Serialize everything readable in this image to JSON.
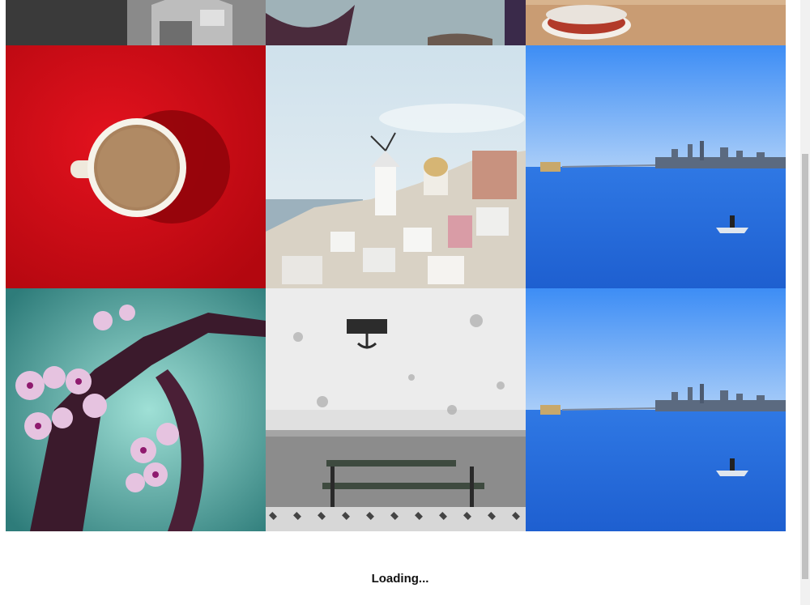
{
  "gallery": {
    "loading_text": "Loading...",
    "tiles": [
      {
        "name": "city-rooftops-photo"
      },
      {
        "name": "sailing-ship-photo"
      },
      {
        "name": "coffee-cup-sand-photo"
      },
      {
        "name": "coffee-cup-red-photo"
      },
      {
        "name": "santorini-photo"
      },
      {
        "name": "sf-bay-boat-photo"
      },
      {
        "name": "cherry-blossom-photo"
      },
      {
        "name": "bench-wall-photo"
      },
      {
        "name": "sf-bay-boat-photo-2"
      }
    ]
  },
  "colors": {
    "background": "#ffffff",
    "scroll_track": "#f1f1f1",
    "scroll_thumb": "#c1c1c1"
  }
}
